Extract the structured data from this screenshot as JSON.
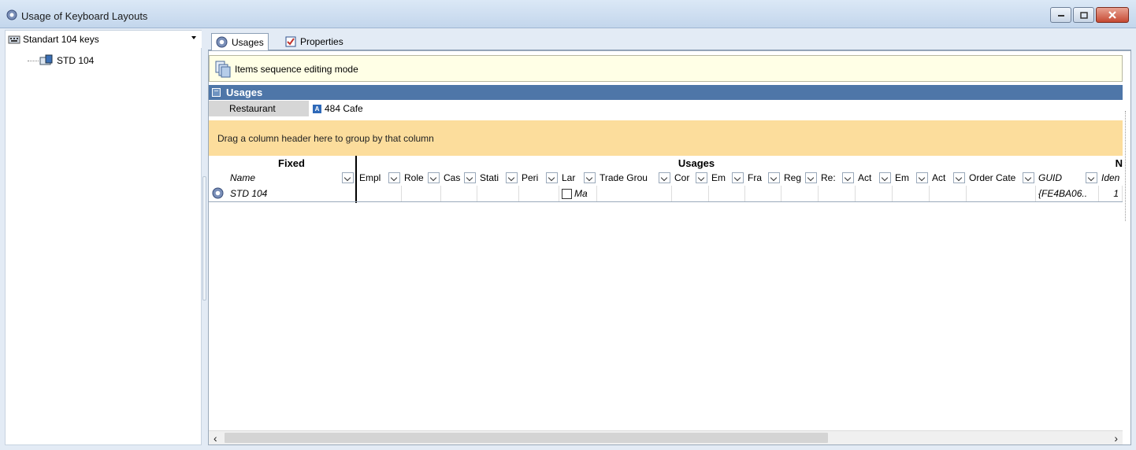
{
  "window": {
    "title": "Usage of Keyboard Layouts",
    "controls": [
      "minimize",
      "maximize",
      "close"
    ]
  },
  "left_panel": {
    "selector_value": "Standart 104 keys",
    "tree": [
      {
        "label": "STD 104"
      }
    ]
  },
  "tabs": [
    {
      "label": "Usages",
      "active": true,
      "icon": "gear-icon"
    },
    {
      "label": "Properties",
      "active": false,
      "icon": "checkbox-icon"
    }
  ],
  "mode_bar": {
    "text": "Items sequence editing mode"
  },
  "usages_section": {
    "title": "Usages",
    "restaurant_label": "Restaurant",
    "restaurant_value": "484 Cafe"
  },
  "group_bar": {
    "text": "Drag a column header here to group by that column"
  },
  "grid": {
    "bands": {
      "fixed": "Fixed",
      "usages": "Usages",
      "right": "N"
    },
    "columns": {
      "name": "Name",
      "c1": "Empl",
      "c2": "Role",
      "c3": "Cas",
      "c4": "Stati",
      "c5": "Peri",
      "c6": "Lar",
      "c7": "Trade Grou",
      "c8": "Cor",
      "c9": "Em",
      "c10": "Fra",
      "c11": "Reg",
      "c12": "Re:",
      "c13": "Act",
      "c14": "Em",
      "c15": "Act",
      "c16": "Order Cate",
      "guid": "GUID",
      "ident": "Iden"
    },
    "rows": [
      {
        "name": "STD 104",
        "lang": "Ma",
        "guid": "{FE4BA06..",
        "ident": "1"
      }
    ]
  }
}
